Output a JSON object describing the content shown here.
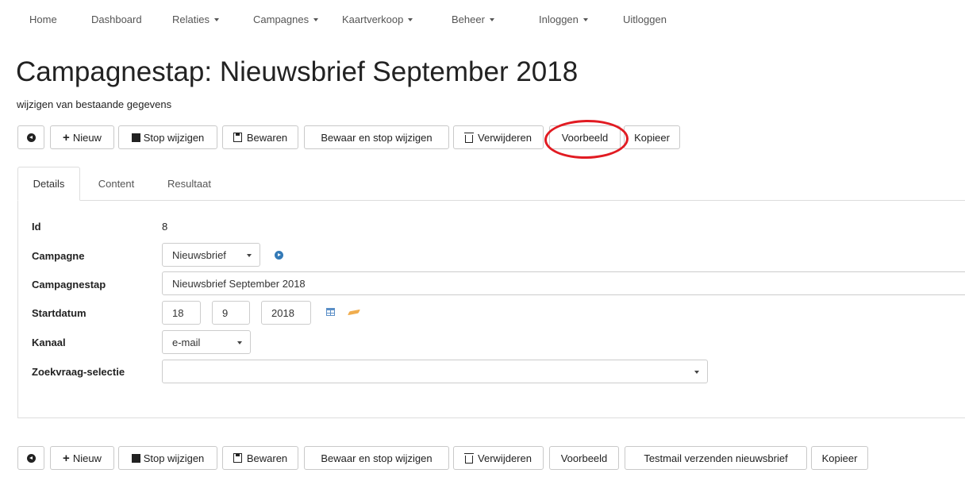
{
  "nav": {
    "home": "Home",
    "dashboard": "Dashboard",
    "relaties": "Relaties",
    "campagnes": "Campagnes",
    "kaartverkoop": "Kaartverkoop",
    "beheer": "Beheer",
    "inloggen": "Inloggen",
    "uitloggen": "Uitloggen"
  },
  "page": {
    "title": "Campagnestap: Nieuwsbrief September 2018",
    "subtitle": "wijzigen van bestaande gegevens"
  },
  "toolbar": {
    "new": "Nieuw",
    "stop_edit": "Stop wijzigen",
    "save": "Bewaren",
    "save_and_stop": "Bewaar en stop wijzigen",
    "delete": "Verwijderen",
    "preview": "Voorbeeld",
    "copy": "Kopieer",
    "send_testmail": "Testmail verzenden nieuwsbrief"
  },
  "tabs": [
    "Details",
    "Content",
    "Resultaat"
  ],
  "form": {
    "id_label": "Id",
    "id_value": "8",
    "campagne_label": "Campagne",
    "campagne_value": "Nieuwsbrief",
    "campagnestap_label": "Campagnestap",
    "campagnestap_value": "Nieuwsbrief September 2018",
    "startdatum_label": "Startdatum",
    "start_day": "18",
    "start_month": "9",
    "start_year": "2018",
    "kanaal_label": "Kanaal",
    "kanaal_value": "e-mail",
    "zoekvraag_label": "Zoekvraag-selectie",
    "zoekvraag_value": ""
  },
  "colors": {
    "highlight": "#e11b22",
    "link_icon": "#337ab7",
    "eraser_icon": "#f0ad4e",
    "calendar_icon": "#5b8fc7"
  }
}
